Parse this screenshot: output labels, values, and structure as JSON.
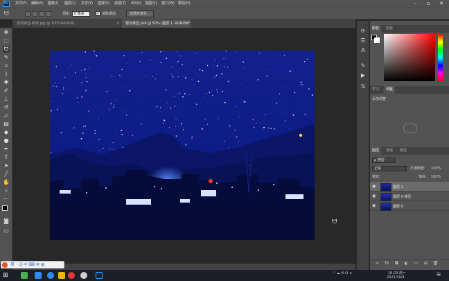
{
  "menubar": {
    "items": [
      "文件(F)",
      "编辑(E)",
      "图像(I)",
      "图层(L)",
      "文字(Y)",
      "选择(S)",
      "滤镜(T)",
      "3D(D)",
      "视图(V)",
      "窗口(W)",
      "帮助(H)"
    ],
    "ps_logo": "Ps"
  },
  "options": {
    "feather_label": "羽化:",
    "feather_value": "0 像素",
    "antialias_label": "消除锯齿",
    "mask_button": "选择并遮住..."
  },
  "tabs": [
    {
      "label": "·银河夜空·制作.jpg @ 100%(RGB/8)",
      "close": "×"
    },
    {
      "label": "银河夜空.psd @ 50% (图层 1, RGB/8) *",
      "close": "×"
    }
  ],
  "panels": {
    "color_tabs": [
      "颜色",
      "色板"
    ],
    "learn_tabs": [
      "学习",
      "调整"
    ],
    "adjust_heading": "添加调整",
    "layers_tabs": [
      "图层",
      "通道",
      "路径"
    ],
    "kind_filter": "ρ 类型",
    "blend_mode": "正常",
    "opacity_label": "不透明度:",
    "opacity_value": "100%",
    "lock_label": "锁定:",
    "fill_label": "填充:",
    "fill_value": "100%",
    "layers": [
      {
        "name": "图层 1",
        "selected": true
      },
      {
        "name": "图层 0 拷贝",
        "selected": false
      },
      {
        "name": "图层 0",
        "selected": false
      }
    ]
  },
  "status": {
    "zoom": "50%"
  },
  "taskbar": {
    "time": "16:23 周一",
    "date": "2021/10/4"
  },
  "colors": {
    "accent": "#31a8ff",
    "sky": "#0c1e84"
  }
}
